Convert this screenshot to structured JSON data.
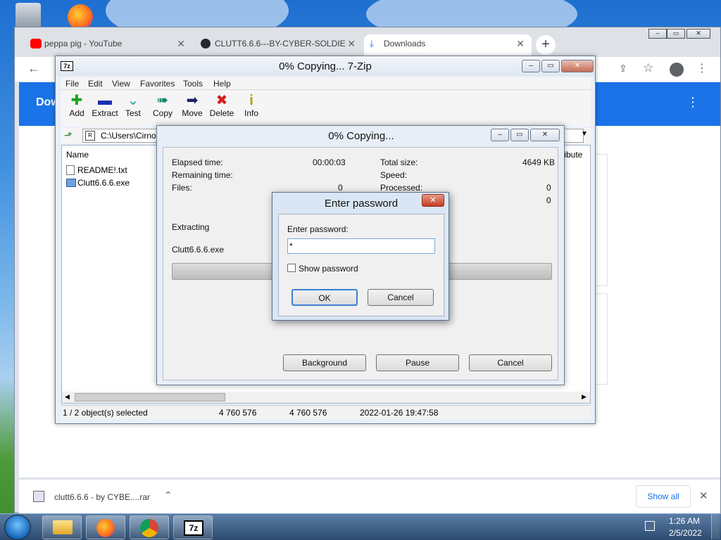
{
  "chrome": {
    "tabs": [
      {
        "label": "peppa pig - YouTube",
        "icon": "youtube-icon"
      },
      {
        "label": "CLUTT6.6.6---BY-CYBER-SOLDIE",
        "icon": "github-icon"
      },
      {
        "label": "Downloads",
        "icon": "download-icon"
      }
    ],
    "page_heading": "Dow",
    "download_item": "clutt6.6.6 - by CYBE....rar",
    "show_all": "Show all"
  },
  "zip": {
    "title": "0% Copying... 7-Zip",
    "menu": [
      "File",
      "Edit",
      "View",
      "Favorites",
      "Tools",
      "Help"
    ],
    "tools": [
      "Add",
      "Extract",
      "Test",
      "Copy",
      "Move",
      "Delete",
      "Info"
    ],
    "path": "C:\\Users\\Cirno",
    "col_name": "Name",
    "col_attr": "tribute",
    "files": [
      "README!.txt",
      "Clutt6.6.6.exe"
    ],
    "status": {
      "selected": "1 / 2 object(s) selected",
      "size1": "4 760 576",
      "size2": "4 760 576",
      "date": "2022-01-26 19:47:58"
    }
  },
  "copy": {
    "title": "0% Copying...",
    "elapsed_label": "Elapsed time:",
    "elapsed_value": "00:00:03",
    "remaining_label": "Remaining time:",
    "files_label": "Files:",
    "files_value": "0",
    "total_label": "Total size:",
    "total_value": "4649 KB",
    "speed_label": "Speed:",
    "processed_label": "Processed:",
    "processed_value": "0",
    "extra_value": "0",
    "action": "Extracting",
    "current_file": "Clutt6.6.6.exe",
    "buttons": {
      "background": "Background",
      "pause": "Pause",
      "cancel": "Cancel"
    }
  },
  "password": {
    "title": "Enter password",
    "label": "Enter password:",
    "value": "*",
    "show_label": "Show password",
    "ok": "OK",
    "cancel": "Cancel"
  },
  "taskbar": {
    "time": "1:26 AM",
    "date": "2/5/2022",
    "apps": [
      "explorer-icon",
      "firefox-icon",
      "chrome-icon",
      "7zip-icon"
    ]
  }
}
